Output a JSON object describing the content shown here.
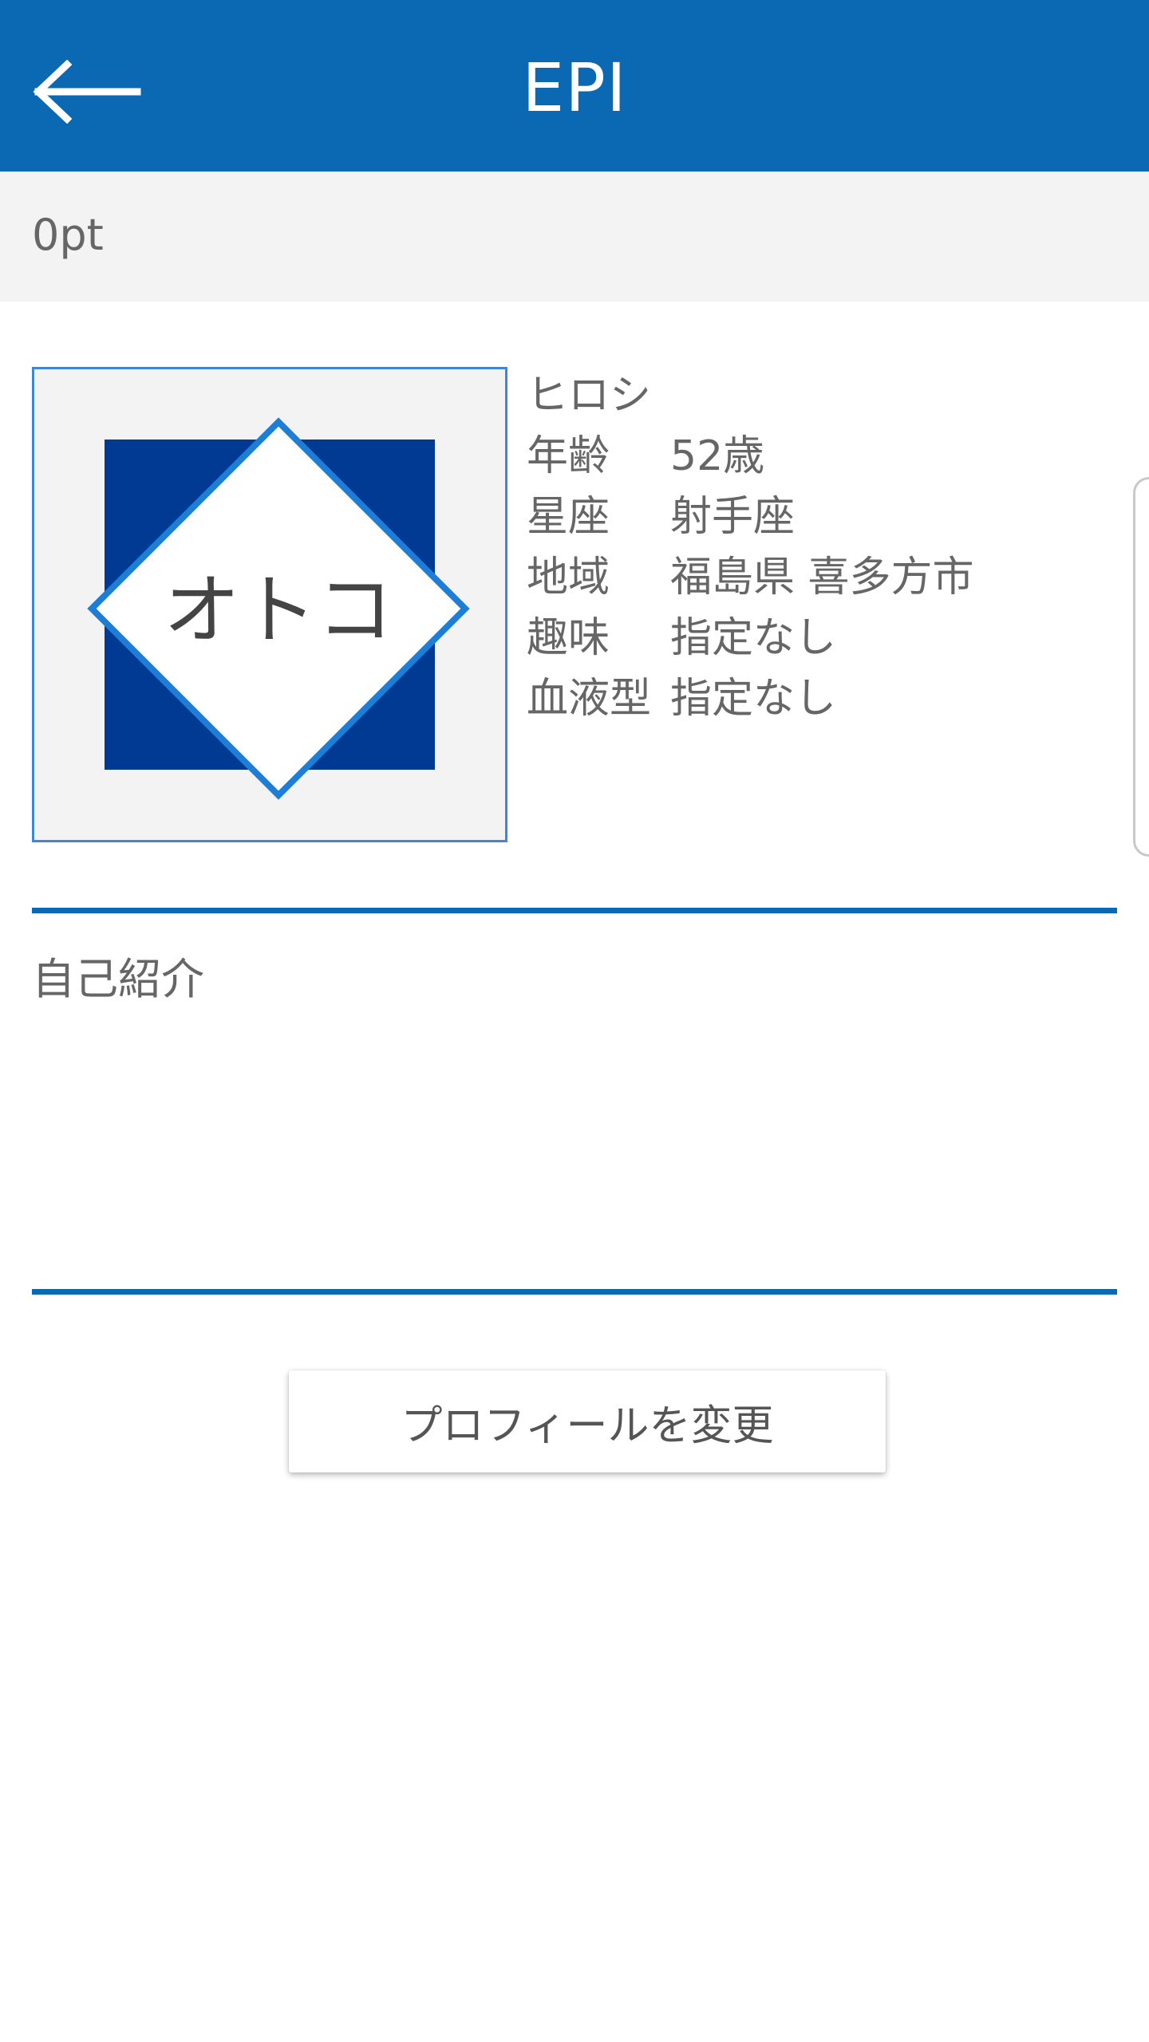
{
  "app_bar": {
    "title": "EPI",
    "back_icon": "arrow-left-icon",
    "background_color": "#0b69b4"
  },
  "points": {
    "value": "0pt"
  },
  "profile": {
    "avatar_label": "オトコ",
    "name": "ヒロシ",
    "fields": [
      {
        "label": "年齢",
        "value": "52歳"
      },
      {
        "label": "星座",
        "value": "射手座"
      },
      {
        "label": "地域",
        "value": "福島県 喜多方市"
      },
      {
        "label": "趣味",
        "value": "指定なし"
      },
      {
        "label": "血液型",
        "value": "指定なし"
      }
    ]
  },
  "self_intro": {
    "heading": "自己紹介",
    "body": ""
  },
  "actions": {
    "edit_profile_label": "プロフィールを変更"
  },
  "colors": {
    "accent": "#0b69b4",
    "avatar_square": "#003a93",
    "avatar_border": "#3d86d8",
    "text": "#666666"
  }
}
